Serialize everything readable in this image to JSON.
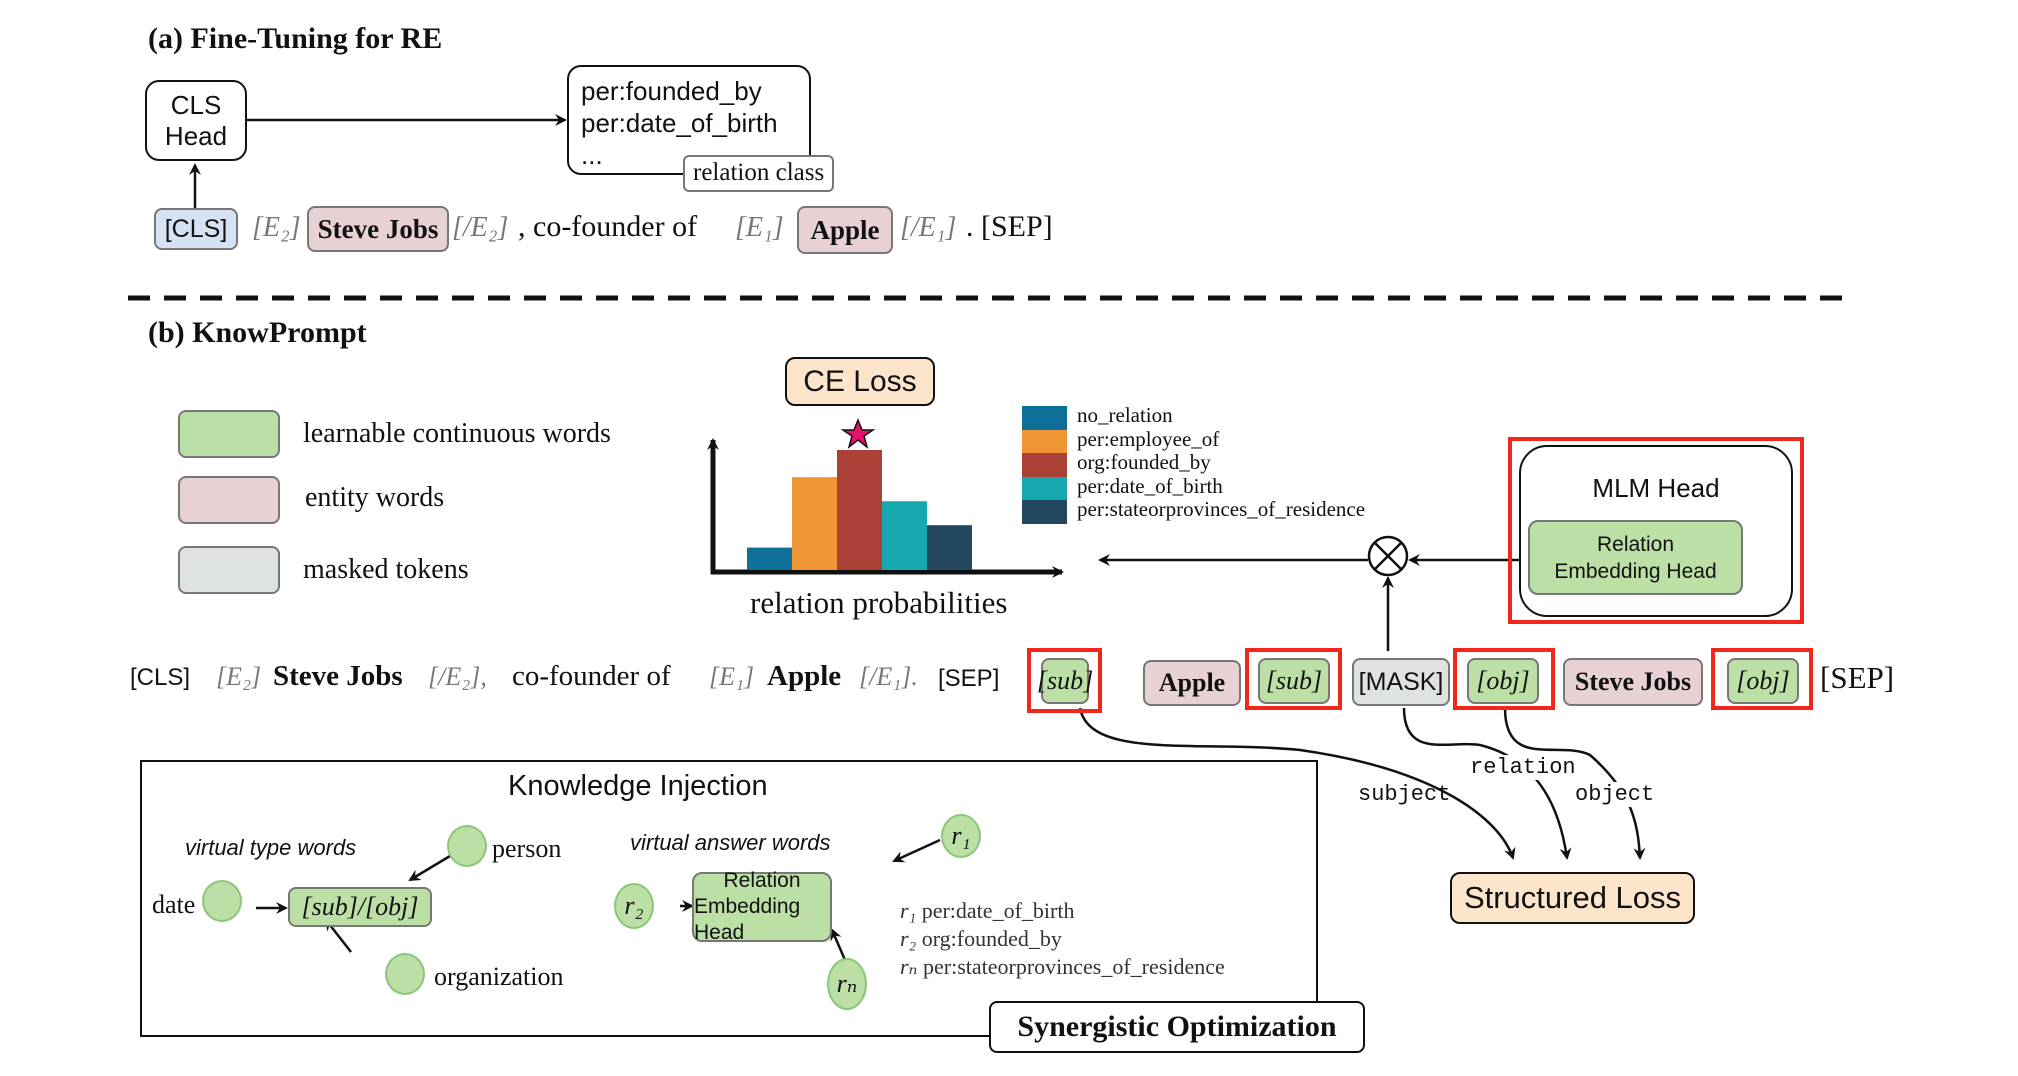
{
  "section_a": {
    "title": "(a) Fine-Tuning for RE",
    "cls_head": {
      "line1": "CLS",
      "line2": "Head"
    },
    "relation_box": {
      "lines": [
        "per:founded_by",
        "per:date_of_birth",
        "..."
      ],
      "tag": "relation class"
    },
    "sentence": {
      "cls": "[CLS]",
      "e2_open": "[E₂]",
      "subject": "Steve Jobs",
      "e2_close": "[/E₂]",
      "middle": ", co-founder of",
      "e1_open": "[E₁]",
      "object": "Apple",
      "e1_close": "[/E₁]",
      "end": ". [SEP]"
    }
  },
  "section_b": {
    "title": "(b) KnowPrompt",
    "legend": [
      {
        "label": "learnable continuous words",
        "color": "#bcdfa6"
      },
      {
        "label": "entity words",
        "color": "#e8d1d3"
      },
      {
        "label": "masked tokens",
        "color": "#dfe3df"
      }
    ],
    "ce_loss": "CE Loss",
    "mlm_head": {
      "title": "MLM Head",
      "inner": {
        "line1": "Relation",
        "line2": "Embedding Head"
      }
    },
    "sentence": {
      "cls": "[CLS]",
      "e2_open": "[E₂]",
      "subject": "Steve Jobs",
      "e2_close": "[/E₂],",
      "middle": "co-founder of",
      "e1_open": "[E₁]",
      "object": "Apple",
      "e1_close": "[/E₁].",
      "sep": "[SEP]"
    },
    "prompt_tokens": [
      {
        "text": "[sub]",
        "kind": "learnable",
        "highlighted": true
      },
      {
        "text": "Apple",
        "kind": "entity",
        "highlighted": false
      },
      {
        "text": "[sub]",
        "kind": "learnable",
        "highlighted": true
      },
      {
        "text": "[MASK]",
        "kind": "masked",
        "highlighted": false
      },
      {
        "text": "[obj]",
        "kind": "learnable",
        "highlighted": true
      },
      {
        "text": "Steve Jobs",
        "kind": "entity",
        "highlighted": false
      },
      {
        "text": "[obj]",
        "kind": "learnable",
        "highlighted": true
      }
    ],
    "prompt_end": "[SEP]",
    "edge_labels": {
      "subject": "subject",
      "relation": "relation",
      "object": "object"
    },
    "structured_loss": "Structured Loss",
    "knowledge_injection": {
      "title": "Knowledge Injection",
      "type_words_label": "virtual type words",
      "type_center": "[sub]/[obj]",
      "type_nodes": [
        "date",
        "person",
        "organization"
      ],
      "answer_words_label": "virtual answer words",
      "answer_center": {
        "line1": "Relation",
        "line2": "Embedding Head"
      },
      "answer_nodes": [
        "r₁",
        "r₂",
        "rₙ"
      ],
      "answer_mapping": [
        {
          "sym": "r₁",
          "label": "per:date_of_birth"
        },
        {
          "sym": "r₂",
          "label": "org:founded_by"
        },
        {
          "sym": "rₙ",
          "label": "per:stateorprovinces_of_residence"
        }
      ]
    },
    "synergistic": "Synergistic Optimization"
  },
  "chart_data": {
    "type": "bar",
    "title": "",
    "xlabel": "relation probabilities",
    "ylabel": "",
    "categories": [
      "no_relation",
      "per:employee_of",
      "org:founded_by",
      "per:date_of_birth",
      "per:stateorprovinces_of_residence"
    ],
    "values": [
      0.14,
      0.58,
      0.75,
      0.43,
      0.28
    ],
    "colors": [
      "#0e7099",
      "#ef9535",
      "#ab4137",
      "#17a9b0",
      "#244760"
    ],
    "ylim": [
      0,
      1
    ],
    "grid": false,
    "legend": "right",
    "annotation": {
      "marker": "star",
      "target": "org:founded_by",
      "color": "#e6116d"
    }
  }
}
